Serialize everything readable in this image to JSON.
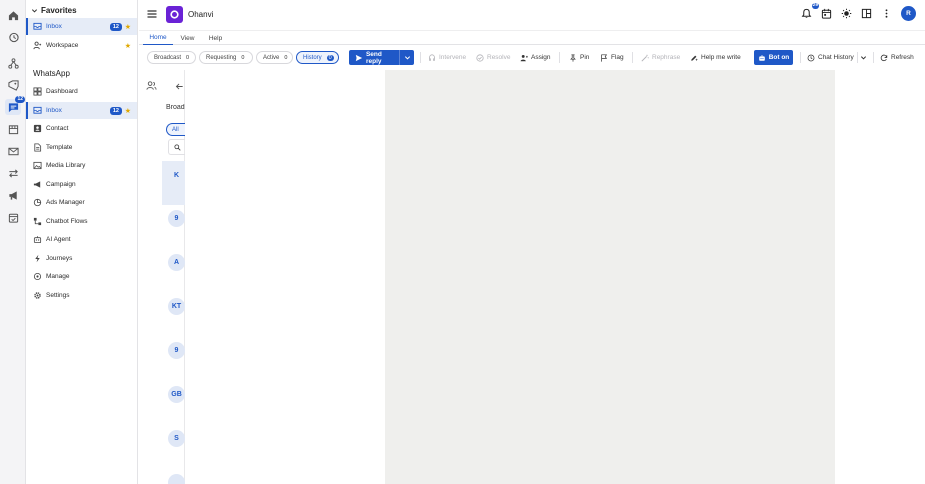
{
  "rail": {
    "items": [
      {
        "icon": "home-icon"
      },
      {
        "icon": "history-icon"
      },
      {
        "icon": "network-icon"
      },
      {
        "icon": "tags-icon"
      },
      {
        "icon": "chat-icon",
        "badge": "12",
        "active": true
      },
      {
        "icon": "store-icon"
      },
      {
        "icon": "mail-icon"
      },
      {
        "icon": "transfer-icon"
      },
      {
        "icon": "megaphone-icon"
      },
      {
        "icon": "calendar-check-icon"
      }
    ]
  },
  "nav": {
    "favorites_label": "Favorites",
    "favorites": [
      {
        "label": "Inbox",
        "badge": "12",
        "starred": true,
        "active": true
      },
      {
        "label": "Workspace",
        "starred": true
      }
    ],
    "section_label": "WhatsApp",
    "items": [
      {
        "label": "Dashboard",
        "icon": "dashboard-icon"
      },
      {
        "label": "Inbox",
        "icon": "inbox-icon",
        "badge": "12",
        "starred": true,
        "active": true
      },
      {
        "label": "Contact",
        "icon": "contact-icon"
      },
      {
        "label": "Template",
        "icon": "template-icon"
      },
      {
        "label": "Media Library",
        "icon": "media-icon"
      },
      {
        "label": "Campaign",
        "icon": "campaign-icon"
      },
      {
        "label": "Ads Manager",
        "icon": "ads-icon"
      },
      {
        "label": "Chatbot Flows",
        "icon": "flows-icon"
      },
      {
        "label": "AI Agent",
        "icon": "ai-agent-icon"
      },
      {
        "label": "Journeys",
        "icon": "bolt-icon"
      },
      {
        "label": "Manage",
        "icon": "manage-icon"
      },
      {
        "label": "Settings",
        "icon": "settings-icon"
      }
    ]
  },
  "header": {
    "app_title": "Ohanvi",
    "notification_count": "29",
    "avatar_initial": "R"
  },
  "tabs": [
    {
      "label": "Home",
      "active": true
    },
    {
      "label": "View"
    },
    {
      "label": "Help"
    }
  ],
  "toolbar": {
    "filters": [
      {
        "label": "Broadcast",
        "count": "0"
      },
      {
        "label": "Requesting",
        "count": "0"
      },
      {
        "label": "Active",
        "count": "0"
      },
      {
        "label": "History",
        "count": "0",
        "active": true
      }
    ],
    "send_reply": "Send reply",
    "intervene": "Intervene",
    "resolve": "Resolve",
    "assign": "Assign",
    "pin": "Pin",
    "flag": "Flag",
    "rephrase": "Rephrase",
    "help_me_write": "Help me write",
    "bot_on": "Bot on",
    "chat_history": "Chat History",
    "refresh": "Refresh"
  },
  "conversation_list": {
    "heading": "Broad",
    "filter_all": "All",
    "rows": [
      {
        "initials": "K",
        "selected": true
      },
      {
        "initials": "9"
      },
      {
        "initials": "A"
      },
      {
        "initials": "KT"
      },
      {
        "initials": "9"
      },
      {
        "initials": "GB"
      },
      {
        "initials": "S"
      }
    ]
  },
  "colors": {
    "accent": "#1f58c7",
    "app_logo": "#6a22d6",
    "star": "#e0a800",
    "chat_bg": "#efefed"
  }
}
